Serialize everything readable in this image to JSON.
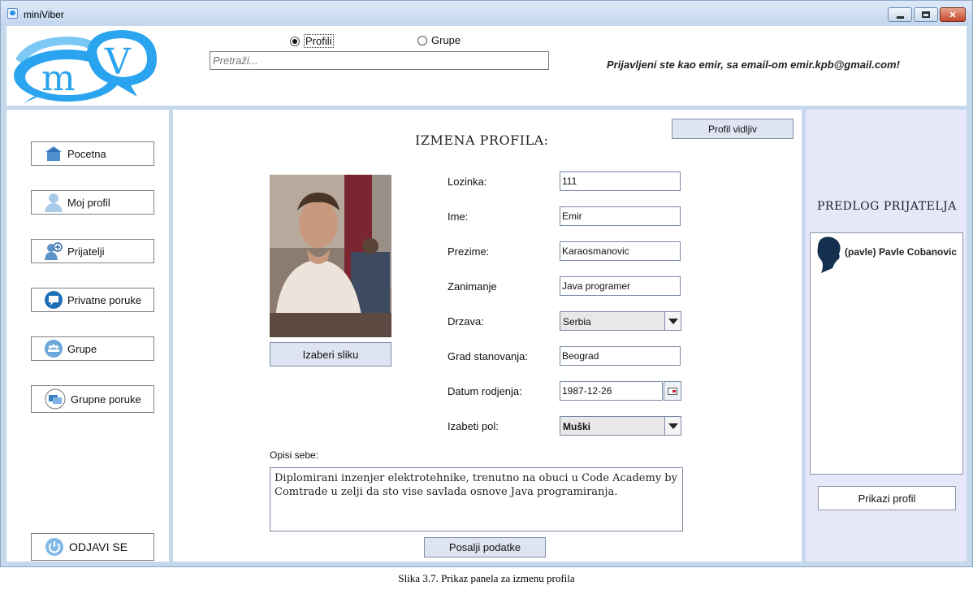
{
  "window": {
    "title": "miniViber",
    "controls": {
      "minimize": "minimize-icon",
      "maximize": "maximize-icon",
      "close": "✕"
    }
  },
  "header": {
    "logo": {
      "letters": "m",
      "letter_v": "V",
      "colors": {
        "bubble": "#2aa4ee",
        "bubble_light": "#7cc8f5"
      }
    },
    "radios": [
      {
        "label": "Profili",
        "selected": true
      },
      {
        "label": "Grupe",
        "selected": false
      }
    ],
    "search": {
      "placeholder": "Pretraži..."
    },
    "logged_in_text": "Prijavljeni ste kao emir, sa email-om emir.kpb@gmail.com!"
  },
  "sidebar": {
    "items": [
      {
        "label": "Pocetna",
        "icon": "home-icon"
      },
      {
        "label": "Moj profil",
        "icon": "user-icon"
      },
      {
        "label": "Prijatelji",
        "icon": "friends-icon"
      },
      {
        "label": "Privatne poruke",
        "icon": "message-icon"
      },
      {
        "label": "Grupe",
        "icon": "group-icon"
      },
      {
        "label": "Grupne poruke",
        "icon": "group-messages-icon"
      }
    ],
    "logout": {
      "label": "ODJAVI SE",
      "icon": "power-icon"
    }
  },
  "main": {
    "visibility_button": "Profil vidljiv",
    "heading": "IZMENA PROFILA:",
    "choose_image_button": "Izaberi sliku",
    "fields": {
      "password": {
        "label": "Lozinka:",
        "value": "111"
      },
      "first_name": {
        "label": "Ime:",
        "value": "Emir"
      },
      "last_name": {
        "label": "Prezime:",
        "value": "Karaosmanovic"
      },
      "occupation": {
        "label": "Zanimanje",
        "value": "Java programer"
      },
      "country": {
        "label": "Drzava:",
        "value": "Serbia"
      },
      "city": {
        "label": "Grad stanovanja:",
        "value": "Beograd"
      },
      "birth_date": {
        "label": "Datum rodjenja:",
        "value": "1987-12-26"
      },
      "gender": {
        "label": "Izabeti pol:",
        "value": "Muški"
      }
    },
    "about": {
      "label": "Opisi sebe:",
      "value": "Diplomirani inzenjer elektrotehnike, trenutno na obuci u Code Academy by Comtrade u zelji da sto vise savlada osnove Java programiranja."
    },
    "submit_button": "Posalji podatke"
  },
  "rightbar": {
    "title": "PREDLOG PRIJATELJA",
    "suggestions": [
      {
        "name": "(pavle) Pavle Cobanovic",
        "icon": "person-silhouette-icon"
      }
    ],
    "show_profile_button": "Prikazi profil"
  },
  "caption": "Slika 3.7. Prikaz panela za izmenu profila",
  "colors": {
    "frame": "#c6d8ec",
    "button_bg": "#dfe4f2",
    "rightbar_bg": "#e6e8fa",
    "accent_blue": "#2aa4ee"
  }
}
